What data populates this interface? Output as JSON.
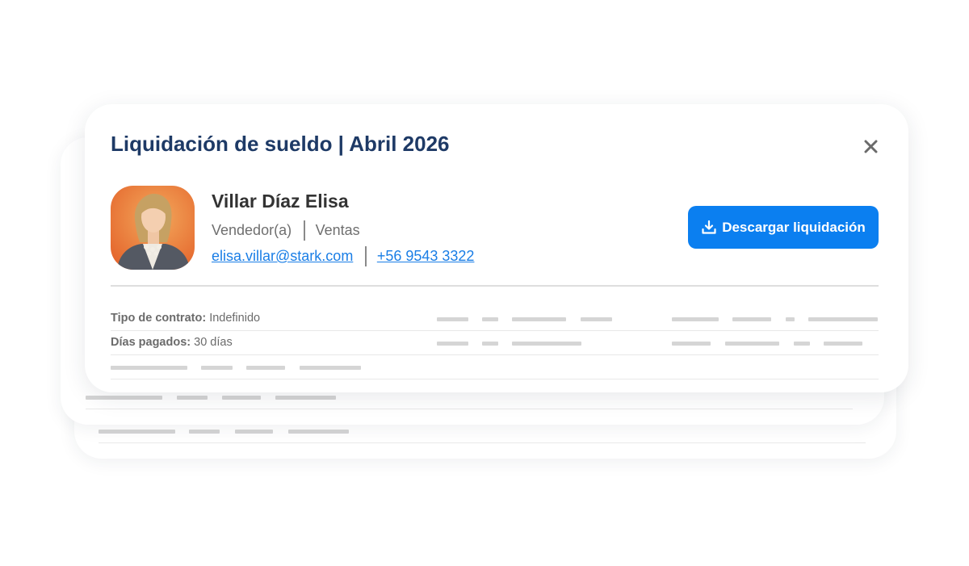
{
  "dialog": {
    "title": "Liquidación de sueldo | Abril 2026",
    "close_icon": "close-icon"
  },
  "employee": {
    "name": "Villar Díaz Elisa",
    "role": "Vendedor(a)",
    "department": "Ventas",
    "email": "elisa.villar@stark.com",
    "phone": "+56 9543 3322",
    "avatar_colors": [
      "#f0a256",
      "#e35e27"
    ]
  },
  "actions": {
    "download_label": "Descargar liquidación",
    "download_icon": "download-icon",
    "accent_color": "#0b7ff0"
  },
  "details": {
    "contract_label": "Tipo de contrato:",
    "contract_value": "Indefinido",
    "days_label": "Días pagados:",
    "days_value": "30 días"
  },
  "colors": {
    "title": "#1e3a66",
    "link": "#1a7ee6",
    "placeholder": "#d5d5d5"
  }
}
